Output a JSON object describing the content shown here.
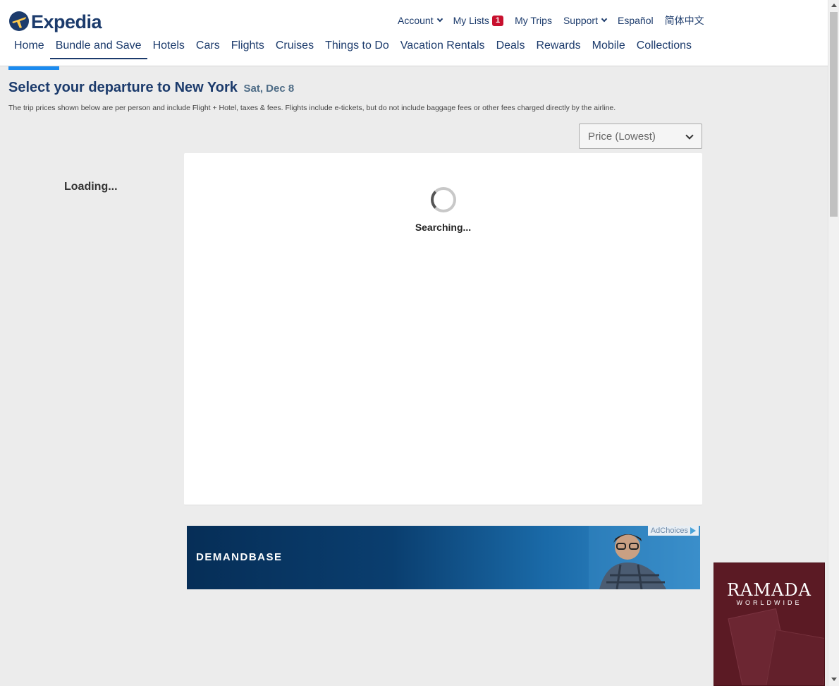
{
  "brand": {
    "name": "Expedia"
  },
  "top_nav": [
    {
      "label": "Account",
      "has_dropdown": true
    },
    {
      "label": "My Lists",
      "badge": "1"
    },
    {
      "label": "My Trips"
    },
    {
      "label": "Support",
      "has_dropdown": true
    },
    {
      "label": "Español"
    },
    {
      "label": "简体中文"
    }
  ],
  "main_nav": [
    {
      "label": "Home"
    },
    {
      "label": "Bundle and Save",
      "active": true
    },
    {
      "label": "Hotels"
    },
    {
      "label": "Cars"
    },
    {
      "label": "Flights"
    },
    {
      "label": "Cruises"
    },
    {
      "label": "Things to Do"
    },
    {
      "label": "Vacation Rentals"
    },
    {
      "label": "Deals"
    },
    {
      "label": "Rewards"
    },
    {
      "label": "Mobile"
    },
    {
      "label": "Collections"
    }
  ],
  "page": {
    "title": "Select your departure to New York",
    "date": "Sat, Dec 8",
    "disclaimer": "The trip prices shown below are per person and include Flight + Hotel, taxes & fees. Flights include e-tickets, but do not include baggage fees or other fees charged directly by the airline."
  },
  "sort": {
    "selected": "Price (Lowest)"
  },
  "filters": {
    "loading_text": "Loading..."
  },
  "results": {
    "status_text": "Searching..."
  },
  "ads": {
    "banner_brand": "DEMANDBASE",
    "adchoices_label": "AdChoices",
    "side_brand": "RAMADA",
    "side_sub": "WORLDWIDE"
  },
  "colors": {
    "brand_navy": "#1c3b6c",
    "accent_blue": "#1b8bef",
    "badge_red": "#c8102e"
  }
}
